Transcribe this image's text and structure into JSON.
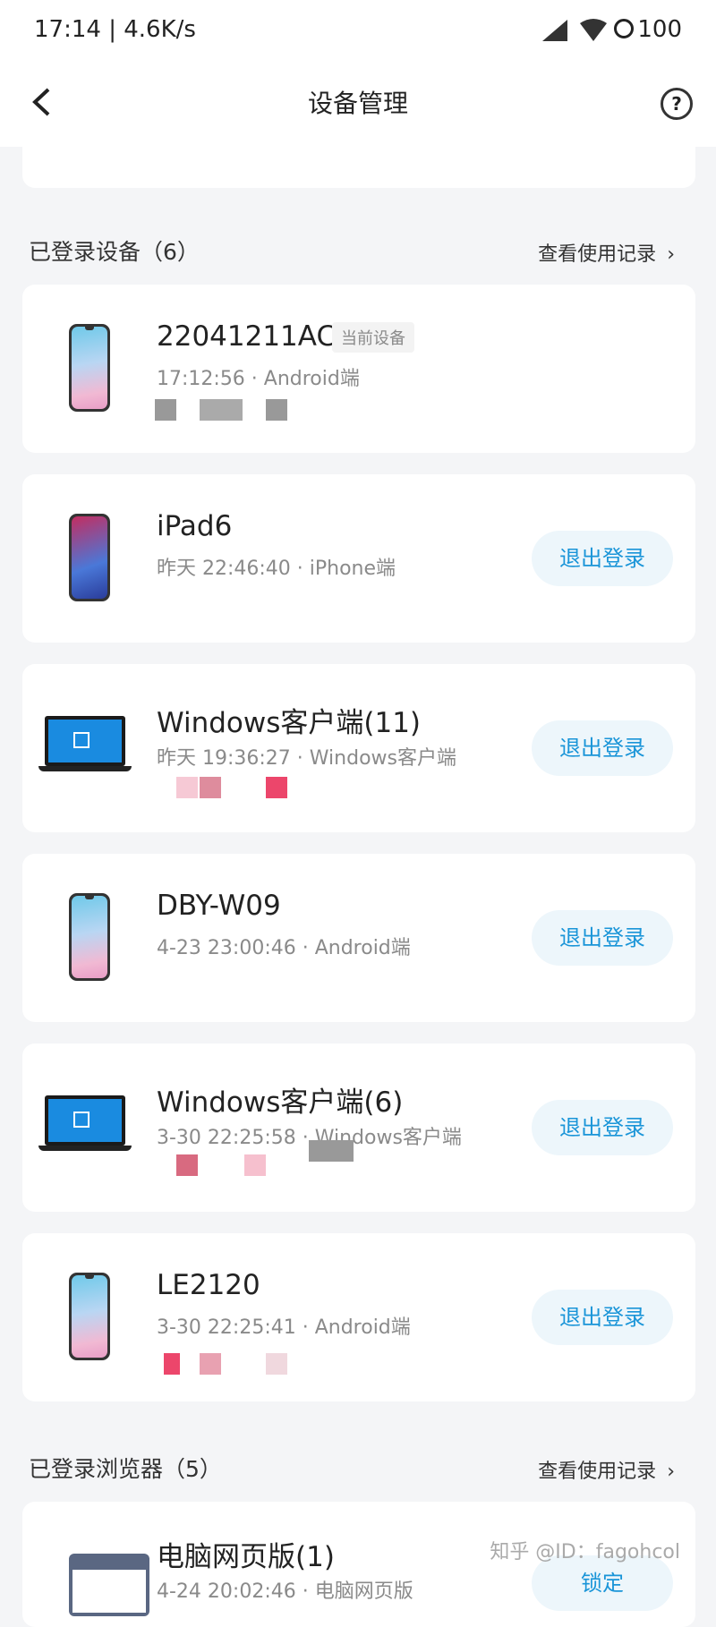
{
  "status_bar": {
    "left": "17:14 | 4.6K/s",
    "right": "100"
  },
  "header": {
    "title": "设备管理"
  },
  "logged_devices": {
    "title": "已登录设备（6）",
    "link": "查看使用记录",
    "items": [
      {
        "name": "22041211AC",
        "badge": "当前设备",
        "sub": "17:12:56 · Android端",
        "icon": "phone-icon"
      },
      {
        "name": "iPad6",
        "sub": "昨天 22:46:40 · iPhone端",
        "action": "退出登录",
        "icon": "iphone-icon"
      },
      {
        "name": "Windows客户端(11)",
        "sub": "昨天 19:36:27 · Windows客户端",
        "action": "退出登录",
        "icon": "laptop-icon"
      },
      {
        "name": "DBY-W09",
        "sub": "4-23 23:00:46 · Android端",
        "action": "退出登录",
        "icon": "phone-icon"
      },
      {
        "name": "Windows客户端(6)",
        "sub": "3-30 22:25:58 · Windows客户端",
        "action": "退出登录",
        "icon": "laptop-icon"
      },
      {
        "name": "LE2120",
        "sub": "3-30 22:25:41 · Android端",
        "action": "退出登录",
        "icon": "phone-icon"
      }
    ]
  },
  "logged_browsers": {
    "title": "已登录浏览器（5）",
    "link": "查看使用记录",
    "items": [
      {
        "name": "电脑网页版(1)",
        "sub": "4-24 20:02:46 · 电脑网页版",
        "action": "锁定",
        "icon": "browser-icon"
      }
    ]
  },
  "watermark": "知乎 @ID：fagohcol"
}
